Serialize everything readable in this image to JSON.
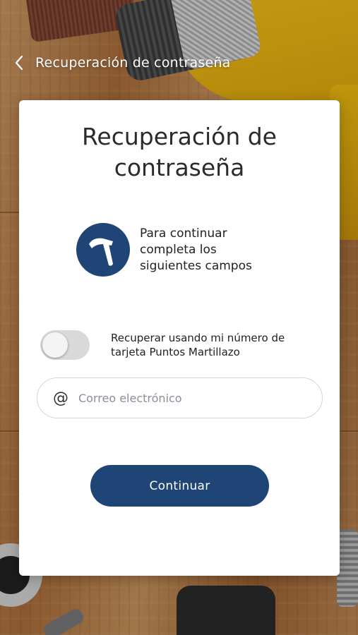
{
  "header": {
    "back_icon": "chevron-left-icon",
    "title": "Recuperación de contraseña"
  },
  "card": {
    "title": "Recuperación de contraseña",
    "logo_icon": "hammer-icon",
    "logo_color": "#1f4576",
    "info_text": "Para continuar completa los siguientes campos",
    "toggle": {
      "label": "Recuperar usando mi número de tarjeta Puntos Martillazo",
      "checked": false
    },
    "email": {
      "icon": "at-icon",
      "value": "",
      "placeholder": "Correo electrónico"
    },
    "continue_label": "Continuar",
    "accent_color": "#1f4576"
  }
}
